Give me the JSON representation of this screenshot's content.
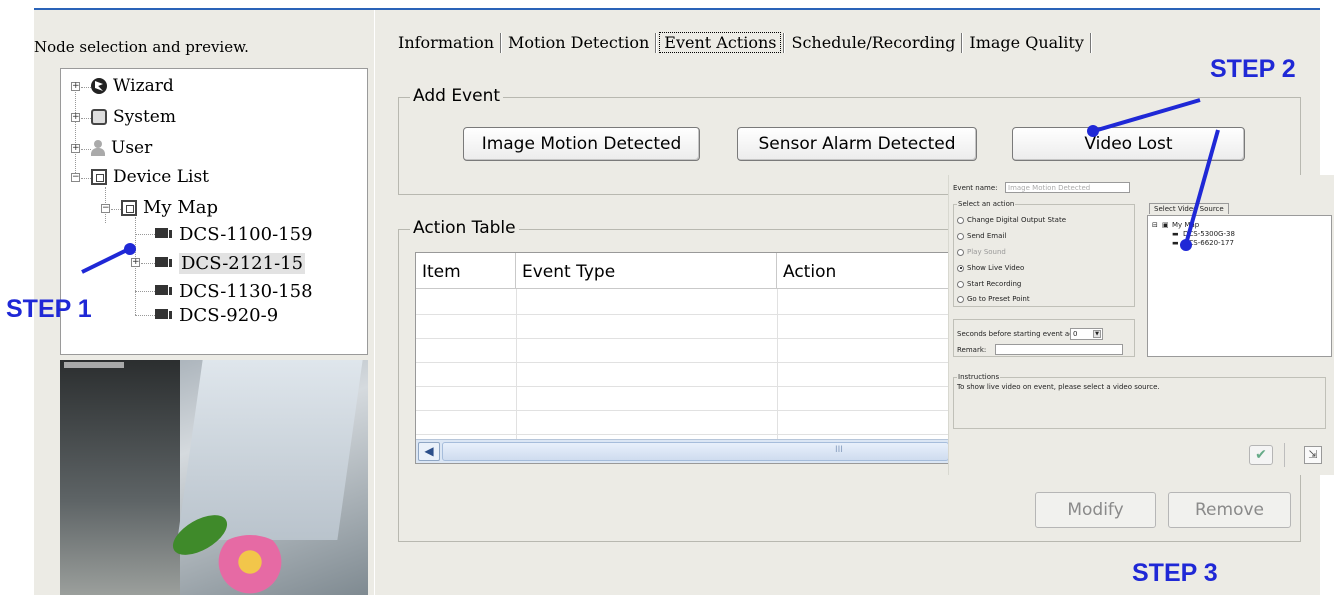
{
  "left_pane": {
    "caption": "Node selection and preview.",
    "tree": {
      "wizard": "Wizard",
      "system": "System",
      "user": "User",
      "device_list": "Device List",
      "my_map": "My Map",
      "devices": [
        "DCS-1100-159",
        "DCS-2121-15",
        "DCS-1130-158",
        "DCS-920-9"
      ],
      "selected_device": "DCS-2121-15"
    }
  },
  "tabs": [
    "Information",
    "Motion Detection",
    "Event Actions",
    "Schedule/Recording",
    "Image Quality"
  ],
  "active_tab": "Event Actions",
  "add_event": {
    "title": "Add Event",
    "buttons": [
      "Image Motion Detected",
      "Sensor Alarm Detected",
      "Video Lost"
    ]
  },
  "action_table": {
    "title": "Action Table",
    "columns": [
      "Item",
      "Event Type",
      "Action"
    ],
    "rows": [],
    "scroll_grip": "III"
  },
  "actions": {
    "modify": "Modify",
    "remove": "Remove"
  },
  "dialog": {
    "event_name_label": "Event name:",
    "event_name_value": "Image Motion Detected",
    "select_action_title": "Select an action",
    "options": [
      "Change Digital Output State",
      "Send Email",
      "Play Sound",
      "Show Live Video",
      "Start Recording",
      "Go to Preset Point"
    ],
    "selected_option": "Show Live Video",
    "disabled_option": "Play Sound",
    "seconds_label": "Seconds before starting event action:",
    "seconds_value": "0",
    "remark_label": "Remark:",
    "source_tab": "Select Video Source",
    "source_tree": {
      "root": "My Map",
      "items": [
        "DCS-5300G-38",
        "DCS-6620-177"
      ]
    },
    "instructions_title": "Instructions",
    "instructions_text": "To show live video on event, please select a video source."
  },
  "annotations": {
    "step1": "STEP 1",
    "step2": "STEP 2",
    "step3": "STEP 3"
  },
  "colors": {
    "annotation": "#1f28d6",
    "accent_rule": "#2a63b8"
  }
}
